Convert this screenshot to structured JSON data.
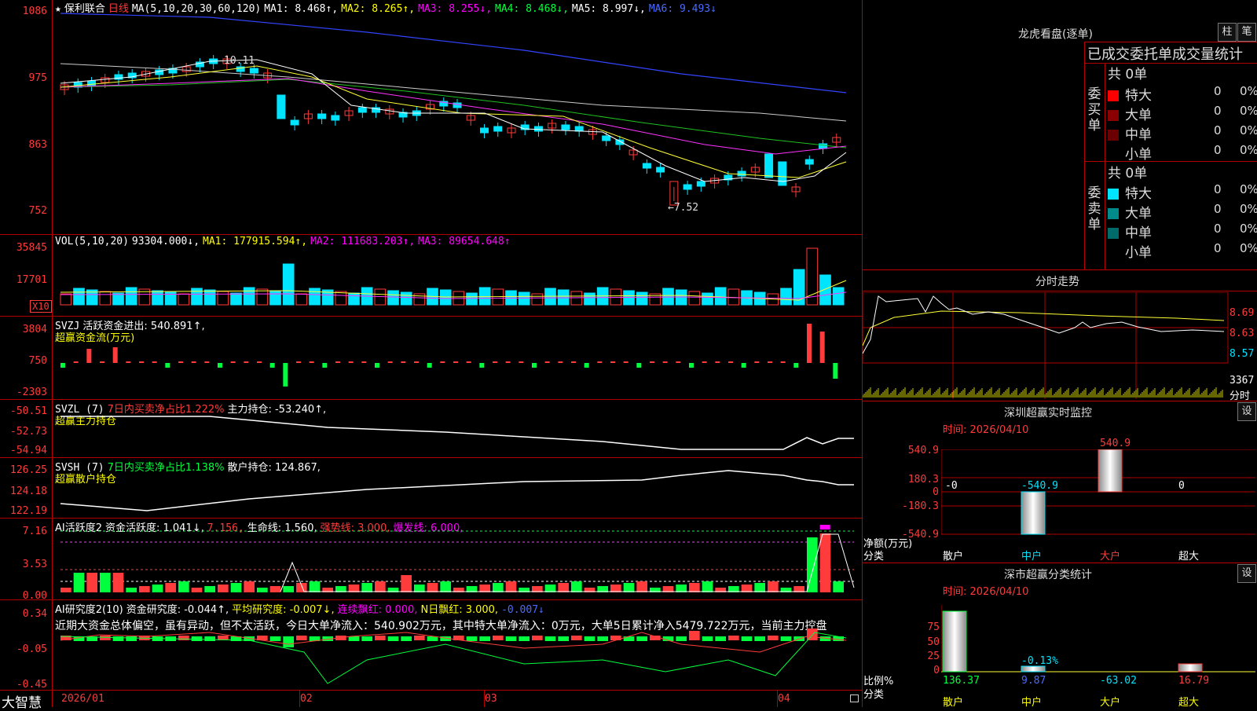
{
  "main_chart": {
    "star": "★",
    "stock_name": "保利联合",
    "period": "日线",
    "ma_label": "MA(5,10,20,30,60,120)",
    "ma1": "MA1: 8.468↑,",
    "ma2": "MA2: 8.265↑,",
    "ma3": "MA3: 8.255↓,",
    "ma4": "MA4: 8.468↓,",
    "ma5": "MA5: 8.997↓,",
    "ma6": "MA6: 9.493↓",
    "y_ticks": [
      "1086",
      "975",
      "863",
      "752"
    ],
    "high_marker": "10.11",
    "low_marker": "←7.52"
  },
  "vol_panel": {
    "label": "VOL(5,10,20)",
    "value": "93304.000↓,",
    "ma1": "MA1: 177915.594↑,",
    "ma2": "MA2: 111683.203↑,",
    "ma3": "MA3: 89654.648↑",
    "y_ticks": [
      "35845",
      "17701"
    ],
    "x10": "X10"
  },
  "svzj_panel": {
    "label": "SVZJ",
    "text1": "活跃资金进出: 540.891↑,",
    "text2": "超赢资金流(万元)",
    "y_ticks": [
      "3804",
      "750",
      "-2303"
    ]
  },
  "svzl_panel": {
    "label": "SVZL (7)",
    "text1": "7日内买卖净占比1.222%",
    "text2": "主力持仓: -53.240↑,",
    "text3": "超赢主力持仓",
    "y_ticks": [
      "-50.51",
      "-52.73",
      "-54.94"
    ]
  },
  "svsh_panel": {
    "label": "SVSH (7)",
    "text1": "7日内买卖净占比1.138%",
    "text2": "散户持仓: 124.867,",
    "text3": "超赢散户持仓",
    "y_ticks": [
      "126.25",
      "124.18",
      "122.19"
    ]
  },
  "ai_active_panel": {
    "label": "AI活跃度2",
    "text1": "资金活跃度: 1.041↓,",
    "text2": "7.156,",
    "text3": "生命线: 1.560,",
    "text4": "强势线: 3.000,",
    "text5": "爆发线: 6.000,",
    "y_ticks": [
      "7.16",
      "3.53",
      "0.00"
    ]
  },
  "ai_research_panel": {
    "label": "AI研究度2(10)",
    "text1": "资金研究度: -0.044↑,",
    "text2": "平均研究度: -0.007↓,",
    "text3": "连续飘红: 0.000,",
    "text4": "N日飘红: 3.000,",
    "text5": "-0.007↓",
    "summary": "近期大资金总体偏空，虽有异动，但不太活跃，今日大单净流入：540.902万元，其中特大单净流入：0万元，大单5日累计净入5479.722万元，当前主力控盘",
    "y_ticks": [
      "0.34",
      "-0.05",
      "-0.45"
    ]
  },
  "bottom_axis": {
    "brand": "大智慧",
    "dates": [
      "2026/01",
      "02",
      "03",
      "04"
    ]
  },
  "right_panel": {
    "top_title": "龙虎看盘(逐单)",
    "btn_zhu": "柱",
    "btn_bi": "笔",
    "tab_header": "已成交委托单成交量统计",
    "buy_label": "委买单",
    "sell_label": "委卖单",
    "buy_total": "共 0单",
    "sell_total": "共 0单",
    "rows": [
      {
        "name": "特大",
        "count": "0",
        "pct": "0%"
      },
      {
        "name": "大单",
        "count": "0",
        "pct": "0%"
      },
      {
        "name": "中单",
        "count": "0",
        "pct": "0%"
      },
      {
        "name": "小单",
        "count": "0",
        "pct": "0%"
      }
    ],
    "intraday_title": "分时走势",
    "intraday_prices": [
      "8.69",
      "8.63",
      "8.57"
    ],
    "intraday_vol": "3367",
    "intraday_vol_unit": "分时",
    "sz_monitor_title": "深圳超赢实时监控",
    "sz_monitor_time": "时间: 2026/04/10",
    "sz_btn": "设",
    "monitor_y": [
      "540.9",
      "180.3",
      "0",
      "-180.3",
      "-540.9"
    ],
    "monitor_labels": [
      "-0",
      "-540.9",
      "540.9",
      "0"
    ],
    "monitor_cats": [
      "散户",
      "中户",
      "大户",
      "超大"
    ],
    "net_label": "净额(万元)",
    "cat_label": "分类",
    "class_title": "深市超赢分类统计",
    "class_time": "时间: 2026/04/10",
    "class_btn": "设",
    "class_y": [
      "75",
      "50",
      "25",
      "0"
    ],
    "class_values": [
      "136.37",
      "9.87",
      "-63.02",
      "16.79"
    ],
    "class_neg_label": "-0.13%",
    "ratio_label": "比例%",
    "class_cats": [
      "散户",
      "中户",
      "大户",
      "超大"
    ]
  }
}
